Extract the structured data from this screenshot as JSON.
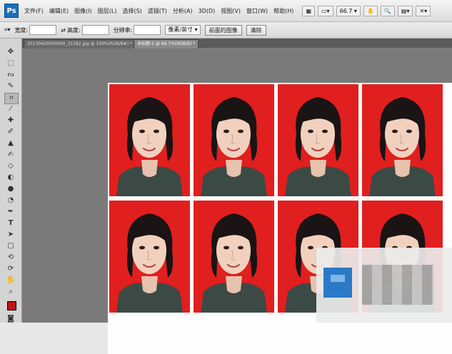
{
  "app": {
    "logo_text": "Ps"
  },
  "menu": [
    "文件(F)",
    "编辑(E)",
    "图像(I)",
    "图层(L)",
    "选择(S)",
    "滤镜(T)",
    "分析(A)",
    "3D(D)",
    "视图(V)",
    "窗口(W)",
    "帮助(H)"
  ],
  "menubar": {
    "zoom": "66.7"
  },
  "options": {
    "width_label": "宽度:",
    "height_label": "高度:",
    "resolution_label": "分辨率:",
    "unit_select": "像素/英寸",
    "front_image_button": "前面的图像",
    "clear_button": "清除"
  },
  "tabs": [
    {
      "label": "20130420000000_31182.jpg @ 100%(RGB/8#) *",
      "active": false
    },
    {
      "label": "未标题-1 @ 66.7%(RGB/8) *",
      "active": true
    }
  ],
  "colors": {
    "background_red": "#e11f1f",
    "foreground_swatch": "#c0141a"
  }
}
